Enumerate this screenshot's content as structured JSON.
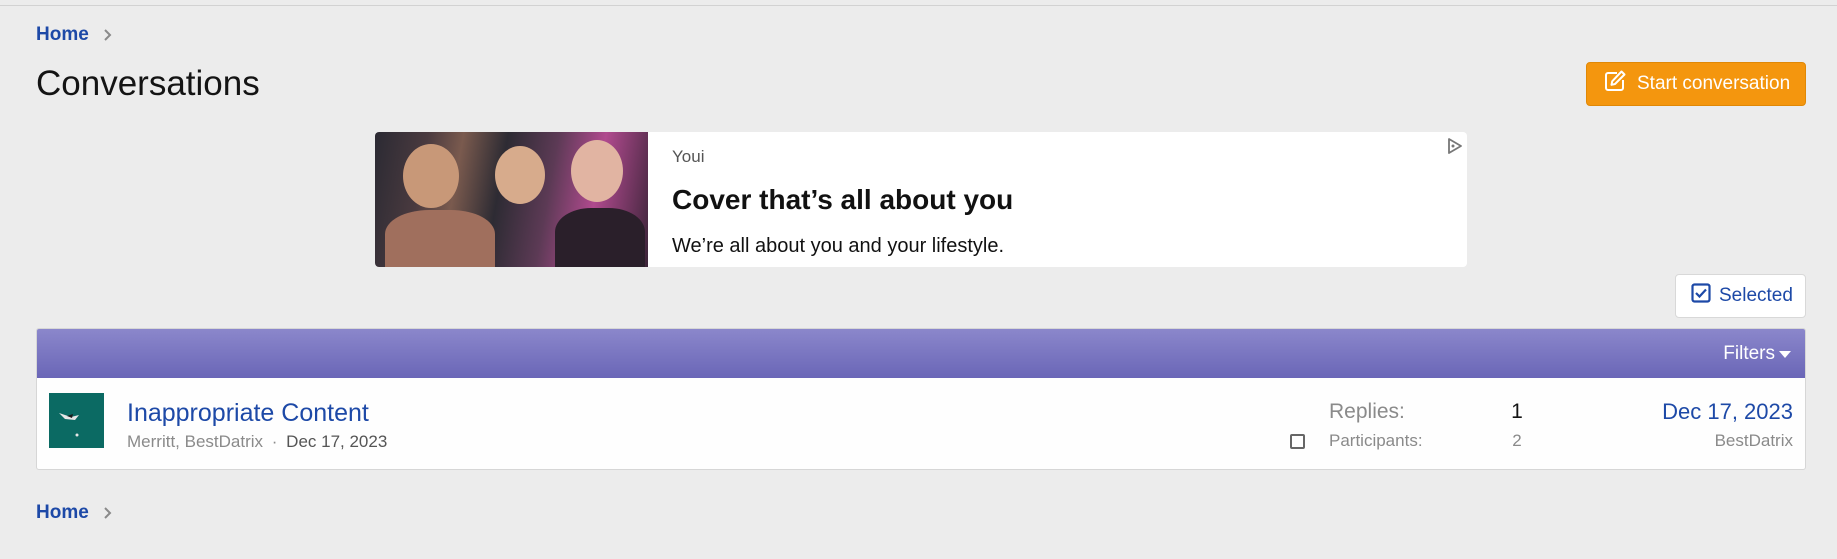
{
  "breadcrumb": {
    "home_label": "Home"
  },
  "page": {
    "title": "Conversations"
  },
  "actions": {
    "start_conversation_label": "Start conversation",
    "selected_label": "Selected"
  },
  "ad": {
    "sponsor": "Youi",
    "headline": "Cover that’s all about you",
    "body": "We’re all about you and your lifestyle."
  },
  "filters": {
    "label": "Filters"
  },
  "conversations": [
    {
      "title": "Inappropriate Content",
      "starters": "Merritt, BestDatrix",
      "separator": "·",
      "start_date": "Dec 17, 2023",
      "replies_label": "Replies:",
      "replies": "1",
      "participants_label": "Participants:",
      "participants": "2",
      "last_date": "Dec 17, 2023",
      "last_user": "BestDatrix"
    }
  ],
  "colors": {
    "accent": "#1d49a7",
    "button": "#f4960e",
    "filter_bar": "#7a76c1",
    "background": "#ececec"
  },
  "icons": {
    "breadcrumb": "chevron-right-icon",
    "start": "edit-icon",
    "selected": "checkbox-checked-icon",
    "filters": "caret-down-icon",
    "ad": "ad-choices-icon"
  }
}
